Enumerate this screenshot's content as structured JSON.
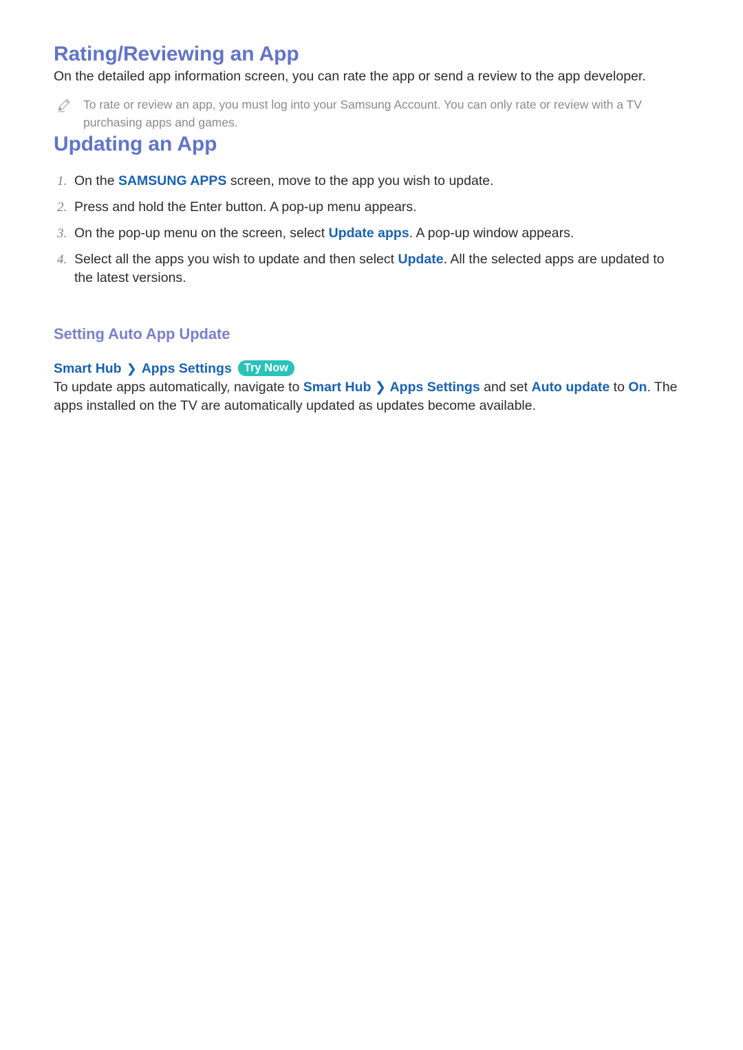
{
  "document": {
    "sections": [
      {
        "title": "Rating/Reviewing an App",
        "intro": "On the detailed app information screen, you can rate the app or send a review to the app developer.",
        "note": {
          "icon": "pencil-icon",
          "text": "To rate or review an app, you must log into your Samsung Account. You can only rate or review with a TV purchasing apps and games."
        }
      },
      {
        "title": "Updating an App",
        "steps": [
          {
            "number": "1.",
            "parts": [
              {
                "text": "On the ",
                "style": "normal"
              },
              {
                "text": "SAMSUNG APPS",
                "style": "keyword"
              },
              {
                "text": " screen, move to the app you wish to update.",
                "style": "normal"
              }
            ]
          },
          {
            "number": "2.",
            "parts": [
              {
                "text": "Press and hold the Enter button. A pop-up menu appears.",
                "style": "normal"
              }
            ]
          },
          {
            "number": "3.",
            "parts": [
              {
                "text": "On the pop-up menu on the screen, select ",
                "style": "normal"
              },
              {
                "text": "Update apps",
                "style": "keyword"
              },
              {
                "text": ". A pop-up window appears.",
                "style": "normal"
              }
            ]
          },
          {
            "number": "4.",
            "parts": [
              {
                "text": "Select all the apps you wish to update and then select ",
                "style": "normal"
              },
              {
                "text": "Update",
                "style": "keyword"
              },
              {
                "text": ". All the selected apps are updated to the latest versions.",
                "style": "normal"
              }
            ]
          }
        ],
        "subsection": {
          "title": "Setting Auto App Update",
          "breadcrumb": {
            "crumb_1": "Smart Hub",
            "separator": "❯",
            "crumb_2": "Apps Settings",
            "badge": "Try Now"
          },
          "paragraph_parts": [
            {
              "text": "To update apps automatically, navigate to ",
              "style": "normal"
            },
            {
              "text": "Smart Hub",
              "style": "keyword"
            },
            {
              "text": " ❯ ",
              "style": "keyword-light"
            },
            {
              "text": "Apps Settings",
              "style": "keyword"
            },
            {
              "text": " and set ",
              "style": "normal"
            },
            {
              "text": "Auto update",
              "style": "keyword"
            },
            {
              "text": " to ",
              "style": "normal"
            },
            {
              "text": "On",
              "style": "keyword"
            },
            {
              "text": ". The apps installed on the TV are automatically updated as updates become available.",
              "style": "normal"
            }
          ]
        }
      }
    ]
  },
  "colors": {
    "heading": "#6274c8",
    "subheading": "#7b81c8",
    "keyword": "#1a62ad",
    "badge_background": "#2ac2b9",
    "body_text": "#2b2b2b",
    "note_text": "#8a8a8a",
    "step_number": "#7d7d7d"
  }
}
